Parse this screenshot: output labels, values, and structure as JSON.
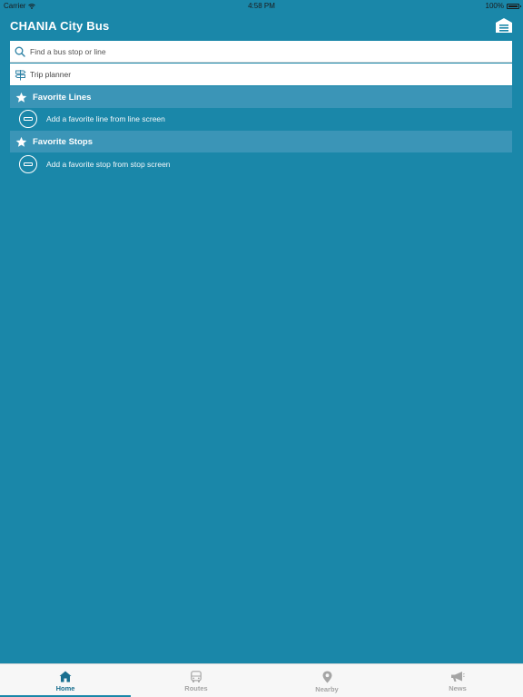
{
  "status_bar": {
    "carrier": "Carrier",
    "time": "4:58 PM",
    "battery": "100%"
  },
  "header": {
    "title": "CHANIA City Bus",
    "menu_icon": "menu-icon"
  },
  "search": {
    "placeholder": "Find a bus stop or line",
    "value": ""
  },
  "trip_planner": {
    "label": "Trip planner"
  },
  "sections": {
    "favorite_lines": {
      "title": "Favorite Lines",
      "hint": "Add a favorite line from line screen"
    },
    "favorite_stops": {
      "title": "Favorite Stops",
      "hint": "Add a favorite stop from stop screen"
    }
  },
  "tabs": [
    {
      "label": "Home",
      "icon": "home-icon",
      "active": true
    },
    {
      "label": "Routes",
      "icon": "bus-icon",
      "active": false
    },
    {
      "label": "Nearby",
      "icon": "location-pin-icon",
      "active": false
    },
    {
      "label": "News",
      "icon": "megaphone-icon",
      "active": false
    }
  ],
  "colors": {
    "background": "#1a87a9",
    "section_header": "#3b95b7",
    "active_tab": "#1a6f8f",
    "inactive_tab": "#a5a5a5"
  }
}
